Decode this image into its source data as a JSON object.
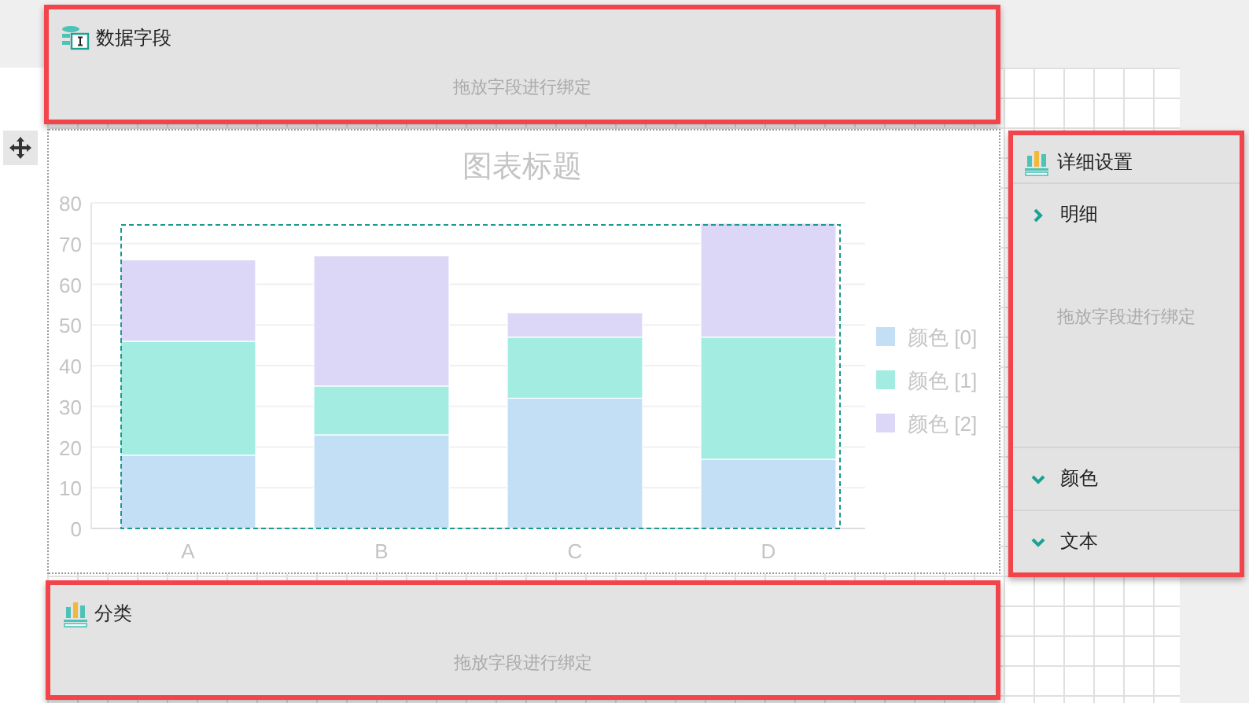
{
  "top_panel": {
    "title": "数据字段",
    "hint": "拖放字段进行绑定"
  },
  "chart": {
    "chart_data": {
      "type": "bar",
      "title": "图表标题",
      "categories": [
        "A",
        "B",
        "C",
        "D"
      ],
      "stacked": true,
      "grid": true,
      "legend": true,
      "ylim": [
        0,
        80
      ],
      "yticks": [
        0,
        10,
        20,
        30,
        40,
        50,
        60,
        70,
        80
      ],
      "series": [
        {
          "name": "颜色 [0]",
          "color": "#c3dff6",
          "values": [
            18,
            23,
            32,
            17
          ]
        },
        {
          "name": "颜色 [1]",
          "color": "#a3ece1",
          "values": [
            28,
            12,
            15,
            30
          ]
        },
        {
          "name": "颜色 [2]",
          "color": "#dcd7f7",
          "values": [
            20,
            32,
            6,
            28
          ]
        }
      ]
    }
  },
  "detail_panel": {
    "title": "详细设置",
    "sections": [
      {
        "label": "明细",
        "expanded": false,
        "hint": "拖放字段进行绑定"
      },
      {
        "label": "颜色",
        "expanded": true
      },
      {
        "label": "文本",
        "expanded": true
      }
    ]
  },
  "category_panel": {
    "title": "分类",
    "hint": "拖放字段进行绑定"
  }
}
